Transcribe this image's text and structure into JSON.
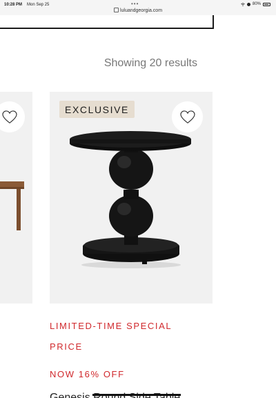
{
  "status_bar": {
    "time": "10:28 PM",
    "date": "Mon Sep 25",
    "dots": "•••",
    "url": "luluandgeorgia.com",
    "battery": "80%"
  },
  "results": {
    "count_text": "Showing 20 results"
  },
  "product_main": {
    "badge": "EXCLUSIVE",
    "promo_line1": "LIMITED-TIME SPECIAL",
    "promo_line2": "PRICE",
    "discount": "NOW 16% OFF",
    "name": "Genesis Round Side Table"
  },
  "colors": {
    "promo": "#d0282c",
    "card_bg": "#f1f1f1",
    "badge_bg": "#e6ddd0",
    "product": "#141414",
    "left_product": "#8a5a36"
  },
  "icons": {
    "wishlist": "heart-outline-icon",
    "lock": "lock-icon",
    "wifi": "wifi-icon",
    "moon": "moon-icon",
    "battery": "battery-icon"
  }
}
